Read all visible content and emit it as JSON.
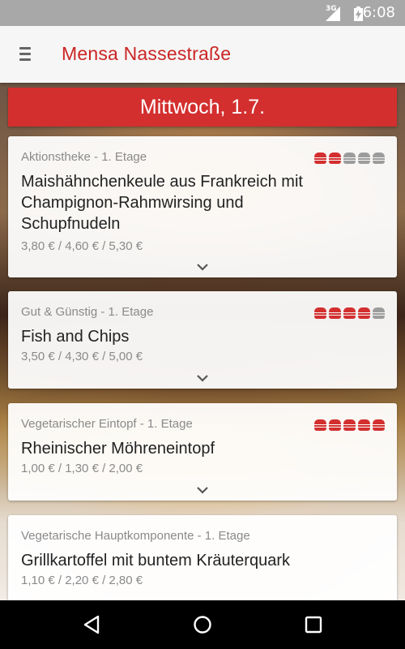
{
  "status_bar": {
    "network": "3G",
    "time": "6:08"
  },
  "app_bar": {
    "menu_icon": "hamburger-menu-icon",
    "title": "Mensa Nassestraße"
  },
  "day_header": "Mittwoch, 1.7.",
  "rating_colors": {
    "filled": "#d32f2f",
    "empty": "#9c9c9c"
  },
  "meals": [
    {
      "category": "Aktionstheke - 1. Etage",
      "name_lines": [
        "Maishähnchenkeule aus Frankreich mit",
        "Champignon-Rahmwirsing und",
        "Schupfnudeln"
      ],
      "prices": "3,80 € / 4,60 € / 5,30 €",
      "rating": 2,
      "rating_max": 5
    },
    {
      "category": "Gut & Günstig - 1. Etage",
      "name_lines": [
        "Fish and Chips"
      ],
      "prices": "3,50 € / 4,30 € / 5,00 €",
      "rating": 4,
      "rating_max": 5
    },
    {
      "category": "Vegetarischer Eintopf - 1. Etage",
      "name_lines": [
        "Rheinischer Möhreneintopf"
      ],
      "prices": "1,00 € / 1,30 € / 2,00 €",
      "rating": 5,
      "rating_max": 5
    },
    {
      "category": "Vegetarische Hauptkomponente - 1. Etage",
      "name_lines": [
        "Grillkartoffel mit buntem Kräuterquark"
      ],
      "prices": "1,10 € / 2,20 € / 2,80 €",
      "rating": null,
      "rating_max": 5
    }
  ],
  "nav_bar": {
    "back": "back-triangle-icon",
    "home": "home-circle-icon",
    "recents": "recents-square-icon"
  }
}
